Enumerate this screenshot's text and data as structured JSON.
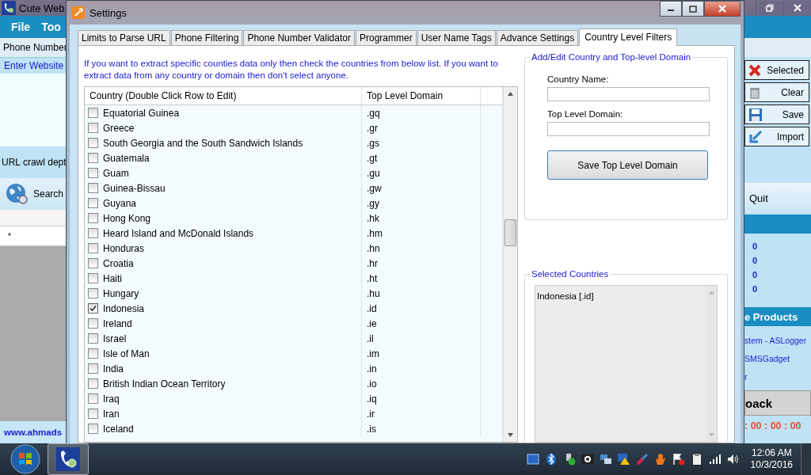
{
  "background_app": {
    "title": "Cute Web",
    "menu": [
      "File",
      "Too"
    ],
    "left": {
      "phone_tab": "Phone Number",
      "website_label": "Enter Website",
      "crawl_label": "URL crawl dept",
      "search_button": "Search",
      "grid_row_marker": "*",
      "footer_link": "www.ahmads"
    },
    "right": {
      "buttons": [
        {
          "kind": "delete",
          "label": "Selected"
        },
        {
          "kind": "clear",
          "label": "Clear"
        },
        {
          "kind": "save",
          "label": "Save"
        },
        {
          "kind": "import",
          "label": "Import"
        }
      ],
      "quit_button": "Quit",
      "counts": [
        "0",
        "0",
        "0",
        "0"
      ],
      "products_header": "e Products",
      "product_links": [
        "stem - ASLogger",
        "SMSGadget",
        "r"
      ],
      "back_button": "oack",
      "timer": ": 00 : 00 : 00"
    }
  },
  "dialog": {
    "title": "Settings",
    "tabs": [
      {
        "label": "Limits to Parse URL",
        "selected": false
      },
      {
        "label": "Phone Filtering",
        "selected": false
      },
      {
        "label": "Phone Number Validator",
        "selected": false
      },
      {
        "label": "Programmer",
        "selected": false
      },
      {
        "label": "User Name Tags",
        "selected": false
      },
      {
        "label": "Advance Settings",
        "selected": false
      },
      {
        "label": "Country Level Filters",
        "selected": true
      }
    ],
    "instructions": "If you want to extract specific counties data only then check the countries from below list. If you want to extract data from any country or domain then don't select anyone.",
    "table": {
      "columns": [
        "Country (Double Click Row to Edit)",
        "Top Level Domain"
      ],
      "rows": [
        {
          "country": "Equatorial Guinea",
          "tld": ".gq",
          "checked": false
        },
        {
          "country": "Greece",
          "tld": ".gr",
          "checked": false
        },
        {
          "country": "South Georgia and the South Sandwich Islands",
          "tld": ".gs",
          "checked": false
        },
        {
          "country": "Guatemala",
          "tld": ".gt",
          "checked": false
        },
        {
          "country": "Guam",
          "tld": ".gu",
          "checked": false
        },
        {
          "country": "Guinea-Bissau",
          "tld": ".gw",
          "checked": false
        },
        {
          "country": "Guyana",
          "tld": ".gy",
          "checked": false
        },
        {
          "country": "Hong Kong",
          "tld": ".hk",
          "checked": false
        },
        {
          "country": "Heard Island and McDonald Islands",
          "tld": ".hm",
          "checked": false
        },
        {
          "country": "Honduras",
          "tld": ".hn",
          "checked": false
        },
        {
          "country": "Croatia",
          "tld": ".hr",
          "checked": false
        },
        {
          "country": "Haiti",
          "tld": ".ht",
          "checked": false
        },
        {
          "country": "Hungary",
          "tld": ".hu",
          "checked": false
        },
        {
          "country": "Indonesia",
          "tld": ".id",
          "checked": true
        },
        {
          "country": "Ireland",
          "tld": ".ie",
          "checked": false
        },
        {
          "country": "Israel",
          "tld": ".il",
          "checked": false
        },
        {
          "country": "Isle of Man",
          "tld": ".im",
          "checked": false
        },
        {
          "country": "India",
          "tld": ".in",
          "checked": false
        },
        {
          "country": "British Indian Ocean Territory",
          "tld": ".io",
          "checked": false
        },
        {
          "country": "Iraq",
          "tld": ".iq",
          "checked": false
        },
        {
          "country": "Iran",
          "tld": ".ir",
          "checked": false
        },
        {
          "country": "Iceland",
          "tld": ".is",
          "checked": false
        }
      ]
    },
    "add_edit": {
      "title": "Add/Edit Country and Top-level Domain",
      "fields": [
        {
          "label": "Country Name:"
        },
        {
          "label": "Top Level Domain:"
        }
      ],
      "button": "Save Top Level Domain"
    },
    "selected_countries": {
      "title": "Selected Countries",
      "items": [
        "Indonesia [.id]"
      ]
    }
  },
  "taskbar": {
    "time": "12:06 AM",
    "date": "10/3/2016"
  }
}
